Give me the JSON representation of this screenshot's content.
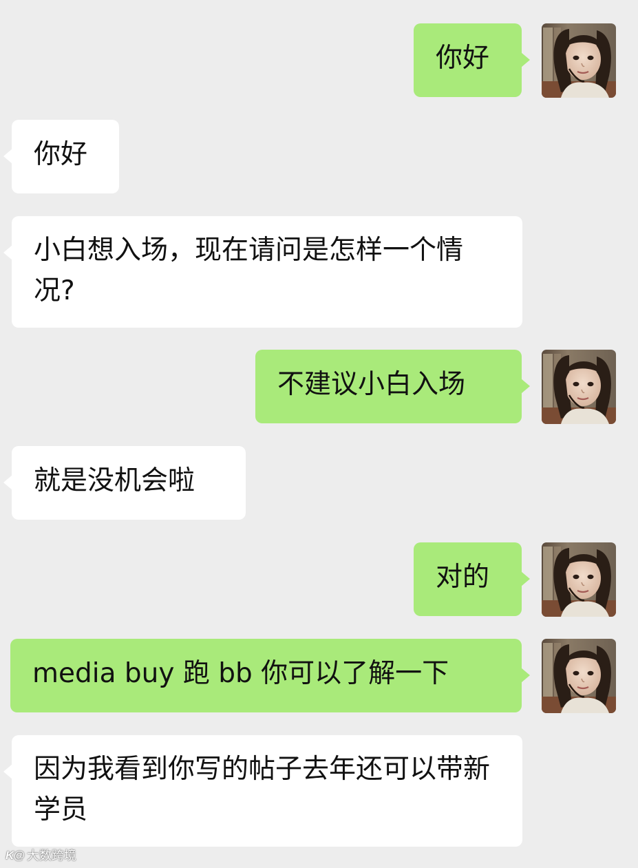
{
  "chat": {
    "messages": [
      {
        "side": "out",
        "text": "你好"
      },
      {
        "side": "in",
        "text": "你好"
      },
      {
        "side": "in",
        "text": "小白想入场，现在请问是怎样一个情况?"
      },
      {
        "side": "out",
        "text": "不建议小白入场"
      },
      {
        "side": "in",
        "text": "就是没机会啦"
      },
      {
        "side": "out",
        "text": "对的"
      },
      {
        "side": "out",
        "text": "media buy 跑 bb 你可以了解一下"
      },
      {
        "side": "in",
        "text": "因为我看到你写的帖子去年还可以带新学员"
      }
    ]
  },
  "watermark": {
    "logo": "K@",
    "text": "大数跨境"
  },
  "colors": {
    "background": "#ededed",
    "outgoing_bubble": "#a9ea7a",
    "incoming_bubble": "#ffffff",
    "text": "#111111"
  },
  "icons": {
    "avatar": "user-photo-avatar"
  }
}
